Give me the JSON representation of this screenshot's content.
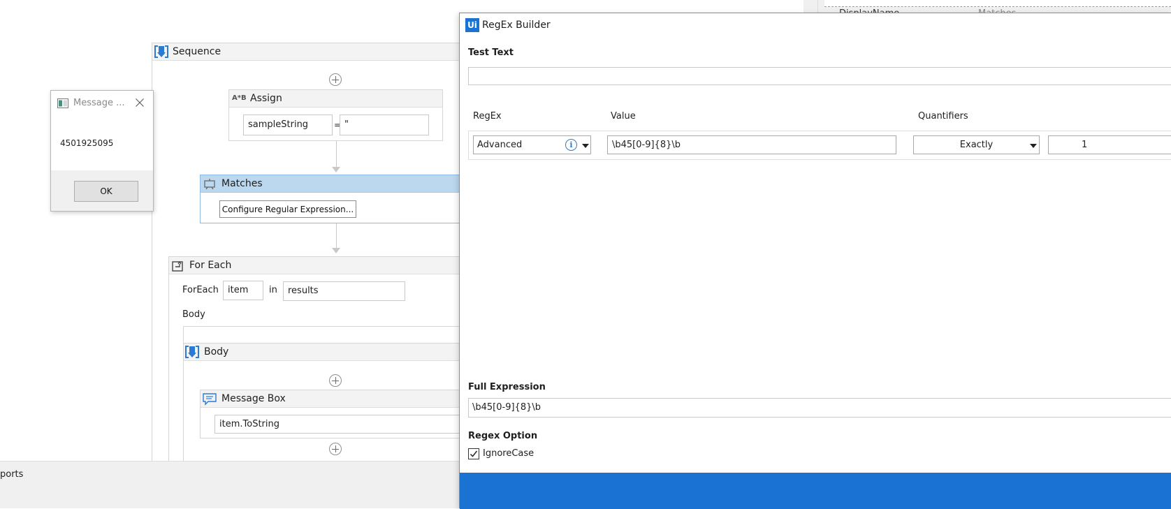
{
  "workflow": {
    "sequence": {
      "title": "Sequence"
    },
    "assign": {
      "title": "Assign",
      "icon": "A*B",
      "to": "sampleString",
      "equals": "=",
      "value": "\""
    },
    "matches": {
      "title": "Matches",
      "configure_button": "Configure Regular Expression..."
    },
    "for_each": {
      "title": "For Each",
      "keyword": "ForEach",
      "item": "item",
      "in_label": "in",
      "collection": "results",
      "body_label": "Body"
    },
    "body": {
      "title": "Body"
    },
    "message_box": {
      "title": "Message Box",
      "text_value": "item.ToString"
    }
  },
  "message_dialog": {
    "title": "Message ...",
    "message": "4501925095",
    "ok_label": "OK"
  },
  "regex_builder": {
    "logo": "Ui",
    "title": "RegEx Builder",
    "test_text_label": "Test Text",
    "test_text_value": "",
    "columns": {
      "regex": "RegEx",
      "value": "Value",
      "quantifiers": "Quantifiers"
    },
    "row": {
      "type": "Advanced",
      "value": "\\b45[0-9]{8}\\b",
      "quantifier": "Exactly",
      "count": "1"
    },
    "full_expression_label": "Full Expression",
    "full_expression_value": "\\b45[0-9]{8}\\b",
    "regex_option_label": "Regex Option",
    "ignore_case_label": "IgnoreCase",
    "ignore_case_checked": true
  },
  "properties_panel": {
    "display_name_label": "DisplayName",
    "display_name_value": "Matches"
  },
  "bottom_panel": {
    "tab_label": "ports"
  },
  "colors": {
    "accent": "#1a73d3",
    "selected_header": "#bcd8ef",
    "info_icon": "#2a7bd3"
  }
}
